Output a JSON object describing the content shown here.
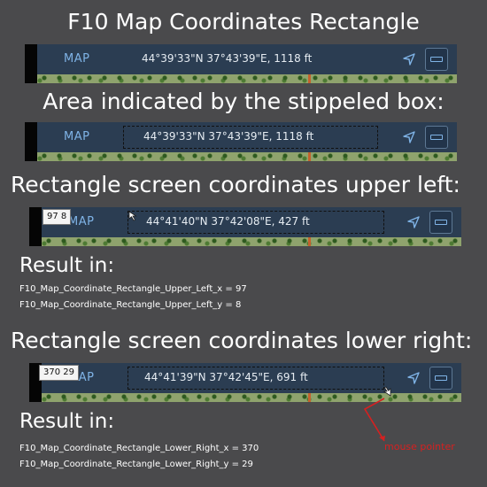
{
  "title": "F10 Map Coordinates Rectangle",
  "map_label": "MAP",
  "colors": {
    "background": "#4a4a4c",
    "bar": "#2b3d52",
    "map_label": "#7fb3e6",
    "arrow": "#d62020"
  },
  "icons": [
    "location-arrow-icon",
    "panel-toggle-icon",
    "mouse-cursor-icon"
  ],
  "strips": [
    {
      "coords": "44°39'33\"N 37°43'39\"E, 1118 ft"
    },
    {
      "coords": "44°39'33\"N 37°43'39\"E, 1118 ft"
    },
    {
      "coords": "44°41'40\"N 37°42'08\"E, 427 ft",
      "tooltip": "97 8"
    },
    {
      "coords": "44°41'39\"N 37°42'45\"E, 691 ft",
      "tooltip": "370 29"
    }
  ],
  "section_area": "Area indicated by the stippeled box:",
  "section_upper_left": "Rectangle screen coordinates upper left:",
  "section_lower_right": "Rectangle screen coordinates lower right:",
  "result_in": "Result in:",
  "result_upper_left": [
    "F10_Map_Coordinate_Rectangle_Upper_Left_x = 97",
    "F10_Map_Coordinate_Rectangle_Upper_Left_y = 8"
  ],
  "result_lower_right": [
    "F10_Map_Coordinate_Rectangle_Lower_Right_x = 370",
    "F10_Map_Coordinate_Rectangle_Lower_Right_y = 29"
  ],
  "mouse_pointer_label": "mouse pointer"
}
